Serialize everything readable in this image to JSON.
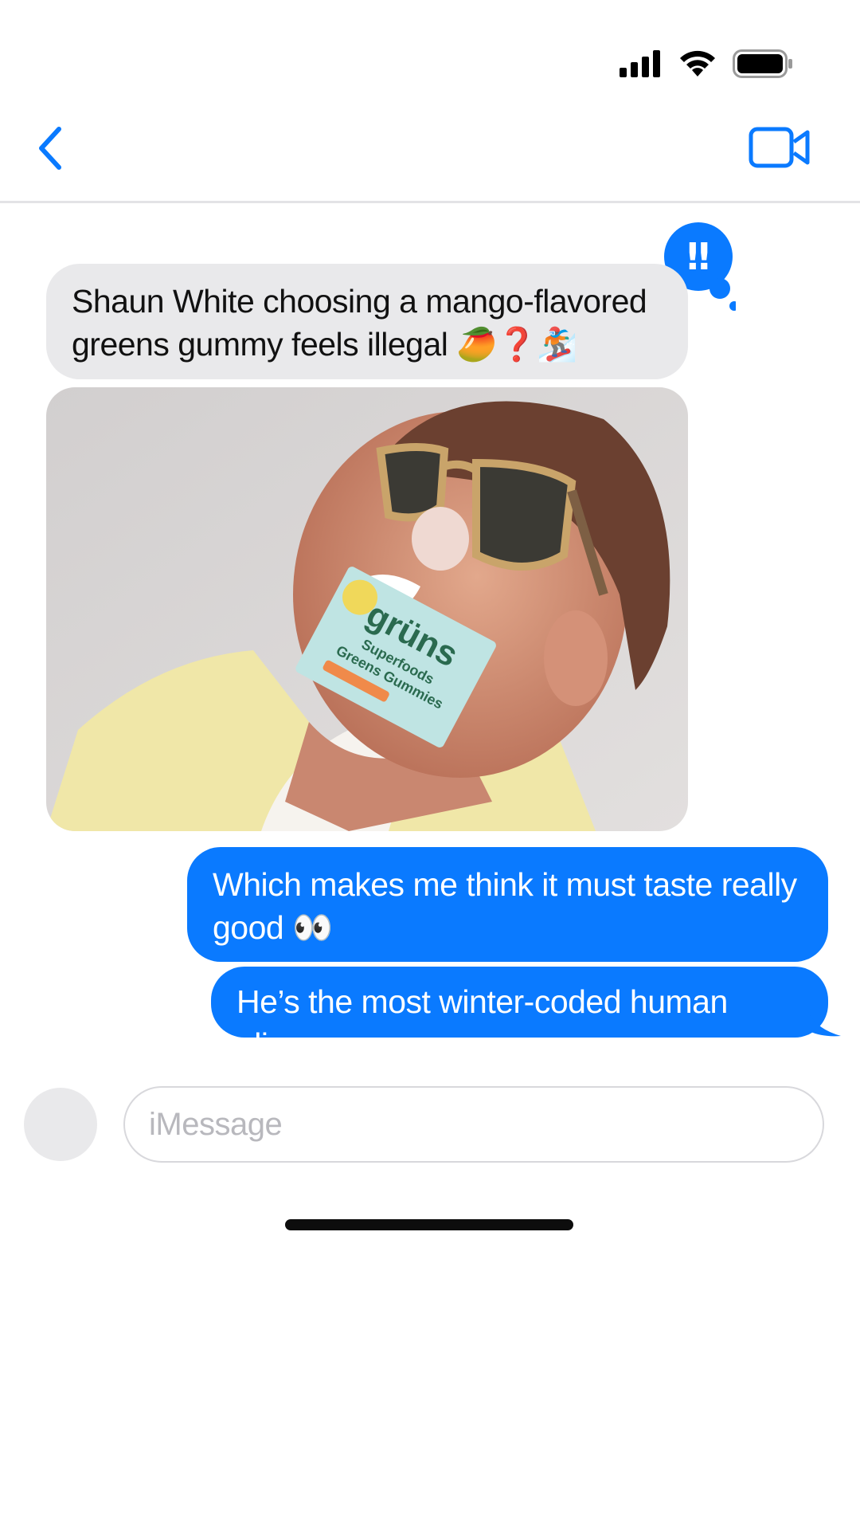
{
  "status_bar": {
    "icons": [
      "cellular-signal-icon",
      "wifi-icon",
      "battery-icon"
    ]
  },
  "nav": {
    "back_icon": "chevron-left-icon",
    "video_icon": "video-camera-icon"
  },
  "conversation": {
    "messages": [
      {
        "direction": "incoming",
        "text": "Shaun White choosing a mango-flavored greens gummy feels illegal 🥭❓🏂"
      },
      {
        "direction": "incoming",
        "type": "photo",
        "alt": "Man in sunglasses holding a grüns gummies pack in his mouth",
        "pack_brand": "grüns",
        "pack_line1": "Superfoods",
        "pack_line2": "Greens Gummies"
      },
      {
        "direction": "outgoing",
        "text": "Which makes me think it must taste really good 👀"
      },
      {
        "direction": "outgoing",
        "text": "He’s the most winter-coded human alive."
      }
    ],
    "tapback": {
      "icon": "exclamation-tapback-icon",
      "label": "‼"
    }
  },
  "composer": {
    "placeholder": "iMessage"
  },
  "colors": {
    "accent": "#0A7AFF",
    "incoming_bubble": "#E9E9EB",
    "background": "#FFFFFF"
  }
}
